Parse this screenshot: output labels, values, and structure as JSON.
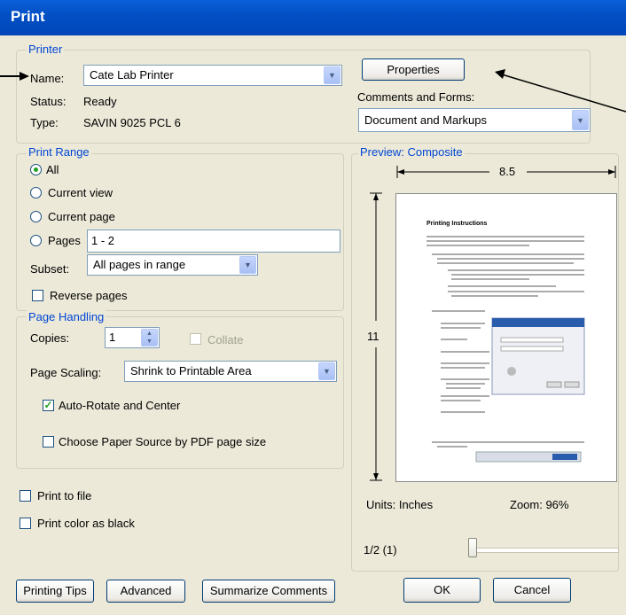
{
  "window": {
    "title": "Print"
  },
  "printer": {
    "group_title": "Printer",
    "name_label": "Name:",
    "name_value": "Cate Lab Printer",
    "status_label": "Status:",
    "status_value": "Ready",
    "type_label": "Type:",
    "type_value": "SAVIN 9025 PCL 6",
    "properties_button": "Properties",
    "comments_forms_label": "Comments and Forms:",
    "comments_forms_value": "Document and Markups"
  },
  "print_range": {
    "group_title": "Print Range",
    "all": "All",
    "current_view": "Current view",
    "current_page": "Current page",
    "pages": "Pages",
    "pages_value": "1 - 2",
    "subset_label": "Subset:",
    "subset_value": "All pages in range",
    "reverse_pages": "Reverse pages",
    "selected": "All"
  },
  "page_handling": {
    "group_title": "Page Handling",
    "copies_label": "Copies:",
    "copies_value": "1",
    "collate": "Collate",
    "page_scaling_label": "Page Scaling:",
    "page_scaling_value": "Shrink to Printable Area",
    "auto_rotate": "Auto-Rotate and Center",
    "auto_rotate_checked": true,
    "choose_paper_source": "Choose Paper Source by PDF page size"
  },
  "options": {
    "print_to_file": "Print to file",
    "print_color_black": "Print color as black"
  },
  "preview": {
    "group_title": "Preview: Composite",
    "width": "8.5",
    "height": "11",
    "units": "Units: Inches",
    "zoom": "Zoom:  96%",
    "page_indicator": "1/2 (1)",
    "doc_heading": "Printing Instructions"
  },
  "buttons": {
    "printing_tips": "Printing Tips",
    "advanced": "Advanced",
    "summarize_comments": "Summarize Comments",
    "ok": "OK",
    "cancel": "Cancel"
  },
  "colors": {
    "title_bar": "#0250c5",
    "group_title": "#0046d5",
    "check_green": "#21a121"
  }
}
